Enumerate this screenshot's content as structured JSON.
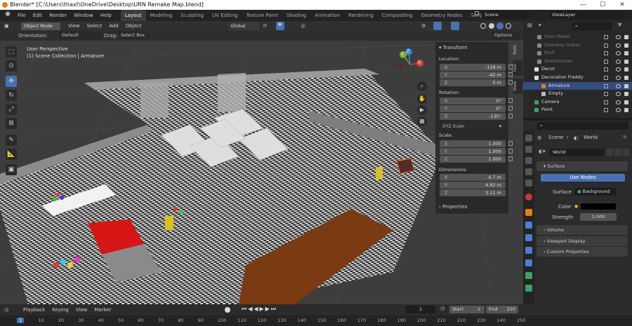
{
  "window": {
    "title": "Blender* [C:\\Users\\thaxt\\OneDrive\\Desktop\\URN Remake Map.blend]",
    "min": "—",
    "max": "☐",
    "close": "✕"
  },
  "menu": [
    "File",
    "Edit",
    "Render",
    "Window",
    "Help"
  ],
  "tabs": [
    "Layout",
    "Modeling",
    "Sculpting",
    "UV Editing",
    "Texture Paint",
    "Shading",
    "Animation",
    "Rendering",
    "Compositing",
    "Geometry Nodes",
    "Scripting"
  ],
  "add_tab": "+",
  "scene": "Scene",
  "view_layer": "ViewLayer",
  "viewport_header": {
    "mode": "Object Mode",
    "view": "View",
    "select": "Select",
    "add": "Add",
    "object": "Object",
    "transform": "Global"
  },
  "viewport_header2": {
    "orientation_label": "Orientation:",
    "orientation": "Default",
    "drag_label": "Drag:",
    "drag": "Select Box",
    "options": "Options"
  },
  "viewport_info": {
    "line1": "User Perspective",
    "line2": "(1) Scene Collection | Armature"
  },
  "gizmo": {
    "x": "X",
    "y": "Y",
    "z": "Z"
  },
  "npanel": {
    "transform_title": "Transform",
    "location_label": "Location:",
    "location": [
      {
        "axis": "X",
        "value": "-118 m"
      },
      {
        "axis": "Y",
        "value": "-42 m"
      },
      {
        "axis": "Z",
        "value": "0 m"
      }
    ],
    "rotation_label": "Rotation:",
    "rotation": [
      {
        "axis": "X",
        "value": "0°"
      },
      {
        "axis": "Y",
        "value": "0°"
      },
      {
        "axis": "Z",
        "value": "-135°"
      }
    ],
    "rotation_mode": "XYZ Euler",
    "scale_label": "Scale:",
    "scale": [
      {
        "axis": "X",
        "value": "1.000"
      },
      {
        "axis": "Y",
        "value": "1.000"
      },
      {
        "axis": "Z",
        "value": "1.000"
      }
    ],
    "dimensions_label": "Dimensions:",
    "dimensions": [
      {
        "axis": "X",
        "value": "4.7 m"
      },
      {
        "axis": "Y",
        "value": "4.92 m"
      },
      {
        "axis": "Z",
        "value": "3.11 m"
      }
    ],
    "properties_title": "Properties"
  },
  "vp_tabs": [
    "Item",
    "Tool",
    "View"
  ],
  "outliner": {
    "rows": [
      {
        "name": "Door Maker",
        "dim": true
      },
      {
        "name": "Doorway maker",
        "dim": true
      },
      {
        "name": "Roof",
        "dim": true
      },
      {
        "name": "Greenscreen",
        "dim": true
      },
      {
        "name": "Decor",
        "dim": false
      },
      {
        "name": "Decoration Freddy",
        "dim": false
      },
      {
        "name": "Armature",
        "dim": false
      },
      {
        "name": "Empty",
        "dim": false
      },
      {
        "name": "Camera",
        "dim": false
      },
      {
        "name": "Point",
        "dim": false
      }
    ]
  },
  "properties": {
    "breadcrumb_scene": "Scene",
    "breadcrumb_sep": "›",
    "breadcrumb_world": "World",
    "world_name": "World",
    "surface_title": "Surface",
    "use_nodes": "Use Nodes",
    "surface_label": "Surface",
    "surface_value": "Background",
    "color_label": "Color",
    "strength_label": "Strength",
    "strength_value": "1.000",
    "volume": "Volume",
    "viewport_display": "Viewport Display",
    "custom_properties": "Custom Properties"
  },
  "timeline": {
    "playback": "Playback",
    "keying": "Keying",
    "view": "View",
    "marker": "Marker",
    "current_frame": "1",
    "start_label": "Start",
    "start": "1",
    "end_label": "End",
    "end": "250",
    "ticks": [
      "1",
      "10",
      "20",
      "30",
      "40",
      "50",
      "60",
      "70",
      "80",
      "90",
      "100",
      "110",
      "120",
      "130",
      "140",
      "150",
      "160",
      "170",
      "180",
      "190",
      "200",
      "210",
      "220",
      "230",
      "240",
      "250"
    ]
  },
  "colors": {
    "accent": "#4772b3",
    "orange": "#e87d0d",
    "viewport": "#3d3d3d"
  }
}
